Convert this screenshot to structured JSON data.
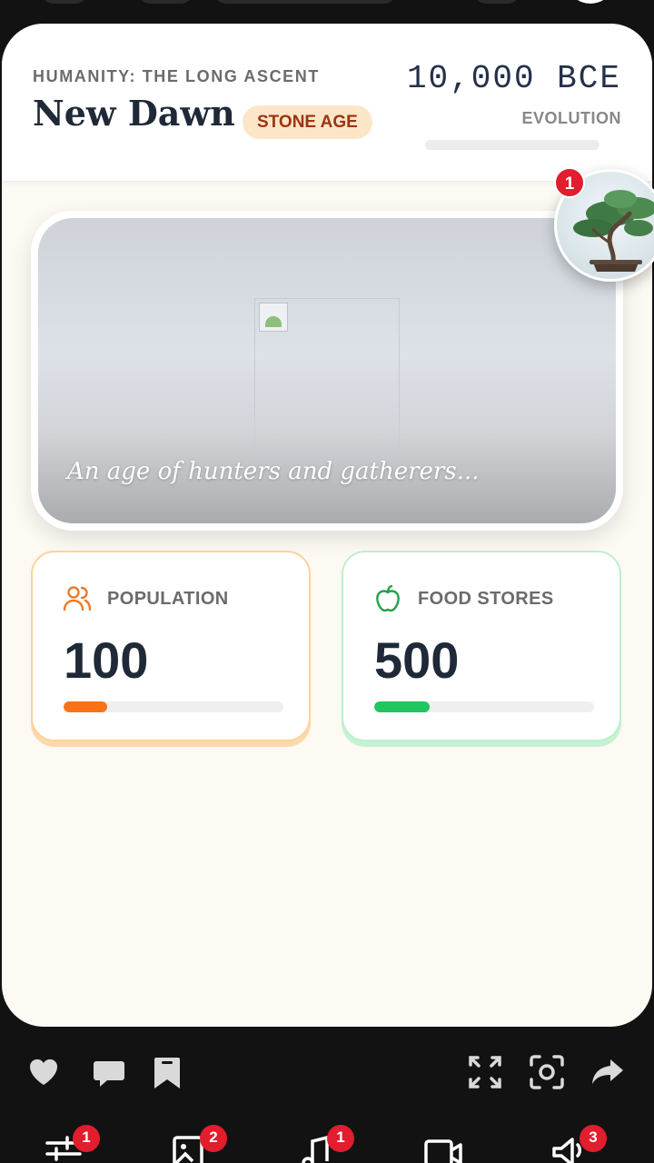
{
  "header": {
    "kicker": "HUMANITY: THE LONG ASCENT",
    "title": "New Dawn",
    "age_badge": "STONE AGE",
    "year": "10,000 BCE",
    "evolution_label": "EVOLUTION",
    "evolution_progress": 0
  },
  "hero": {
    "caption": "An age of hunters and gatherers..."
  },
  "stats": {
    "population": {
      "label": "POPULATION",
      "value": "100",
      "progress": 0.2,
      "color": "#f97316"
    },
    "food": {
      "label": "FOOD STORES",
      "value": "500",
      "progress": 0.25,
      "color": "#22c55e"
    }
  },
  "avatar": {
    "badge": "1",
    "icon": "bonsai-tree-icon"
  },
  "actions": {
    "left": [
      "heart-icon",
      "comment-icon",
      "bookmark-icon"
    ],
    "right": [
      "expand-icon",
      "screenshot-icon",
      "share-icon"
    ]
  },
  "nav": {
    "items": [
      {
        "icon": "sliders-icon",
        "badge": "1"
      },
      {
        "icon": "image-icon",
        "badge": "2"
      },
      {
        "icon": "music-icon",
        "badge": "1"
      },
      {
        "icon": "video-icon",
        "badge": ""
      },
      {
        "icon": "speaker-icon",
        "badge": "3"
      }
    ]
  },
  "colors": {
    "accent_badge": "#e11d2e",
    "badge_bg": "#fde6c8",
    "badge_text": "#9a3412"
  }
}
